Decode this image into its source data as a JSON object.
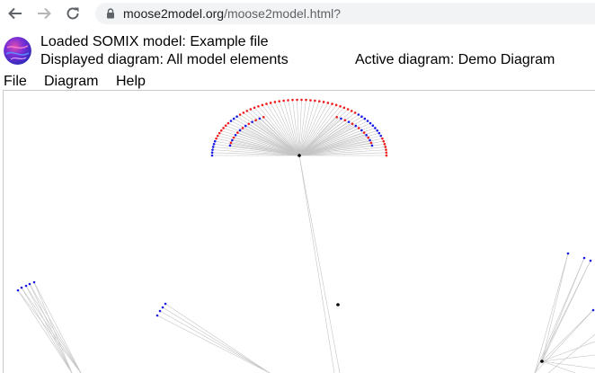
{
  "browser": {
    "url_host": "moose2model.org",
    "url_path": "/moose2model.html?"
  },
  "header": {
    "loaded_model": "Loaded SOMIX model: Example file",
    "displayed_diagram": "Displayed diagram: All model elements",
    "active_diagram": "Active diagram: Demo Diagram"
  },
  "menu": {
    "items": [
      {
        "label": "File"
      },
      {
        "label": "Diagram"
      },
      {
        "label": "Help"
      }
    ]
  },
  "colors": {
    "node_red": "#ee1c1c",
    "node_blue": "#1a1ae6",
    "node_black": "#000000",
    "edge": "#c4c4c4"
  }
}
